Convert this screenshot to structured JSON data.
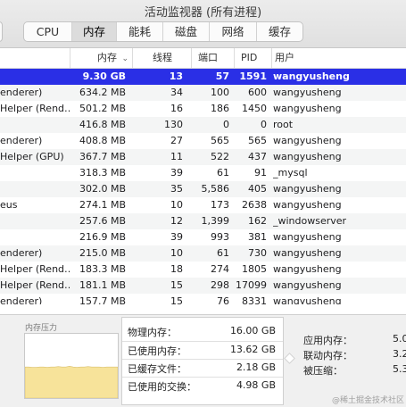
{
  "window": {
    "title": "活动监视器 (所有进程)"
  },
  "tabs": [
    {
      "label": "CPU",
      "active": false
    },
    {
      "label": "内存",
      "active": true
    },
    {
      "label": "能耗",
      "active": false
    },
    {
      "label": "磁盘",
      "active": false
    },
    {
      "label": "网络",
      "active": false
    },
    {
      "label": "缓存",
      "active": false
    }
  ],
  "table": {
    "headers": {
      "memory": "内存",
      "threads": "线程",
      "ports": "端口",
      "pid": "PID",
      "user": "用户"
    },
    "sort_indicator": "⌄",
    "rows": [
      {
        "name": "",
        "memory": "9.30 GB",
        "threads": "13",
        "ports": "57",
        "pid": "1591",
        "user": "wangyusheng",
        "selected": true
      },
      {
        "name": "enderer)",
        "memory": "634.2 MB",
        "threads": "34",
        "ports": "100",
        "pid": "600",
        "user": "wangyusheng"
      },
      {
        "name": "Helper (Rend…",
        "memory": "501.2 MB",
        "threads": "16",
        "ports": "186",
        "pid": "1450",
        "user": "wangyusheng"
      },
      {
        "name": "",
        "memory": "416.8 MB",
        "threads": "130",
        "ports": "0",
        "pid": "0",
        "user": "root"
      },
      {
        "name": "enderer)",
        "memory": "408.8 MB",
        "threads": "27",
        "ports": "565",
        "pid": "565",
        "user": "wangyusheng"
      },
      {
        "name": "Helper (GPU)",
        "memory": "367.7 MB",
        "threads": "11",
        "ports": "522",
        "pid": "437",
        "user": "wangyusheng"
      },
      {
        "name": "",
        "memory": "318.3 MB",
        "threads": "39",
        "ports": "61",
        "pid": "91",
        "user": "_mysql"
      },
      {
        "name": "",
        "memory": "302.0 MB",
        "threads": "35",
        "ports": "5,586",
        "pid": "405",
        "user": "wangyusheng"
      },
      {
        "name": "eus",
        "memory": "274.1 MB",
        "threads": "10",
        "ports": "173",
        "pid": "2638",
        "user": "wangyusheng"
      },
      {
        "name": "",
        "memory": "257.6 MB",
        "threads": "12",
        "ports": "1,399",
        "pid": "162",
        "user": "_windowserver"
      },
      {
        "name": "",
        "memory": "216.9 MB",
        "threads": "39",
        "ports": "993",
        "pid": "381",
        "user": "wangyusheng"
      },
      {
        "name": "enderer)",
        "memory": "215.0 MB",
        "threads": "10",
        "ports": "61",
        "pid": "730",
        "user": "wangyusheng"
      },
      {
        "name": "Helper (Rend…",
        "memory": "183.3 MB",
        "threads": "18",
        "ports": "274",
        "pid": "1805",
        "user": "wangyusheng"
      },
      {
        "name": "Helper (Rend…",
        "memory": "181.1 MB",
        "threads": "15",
        "ports": "298",
        "pid": "17099",
        "user": "wangyusheng"
      },
      {
        "name": "enderer)",
        "memory": "157.7 MB",
        "threads": "15",
        "ports": "76",
        "pid": "8331",
        "user": "wangyusheng"
      }
    ]
  },
  "memory_pressure": {
    "label": "内存压力",
    "fill_color": "#f7e39a",
    "levels": [
      0.78,
      0.78,
      0.77,
      0.77,
      0.78,
      0.78,
      0.77,
      0.78,
      0.78,
      0.79,
      0.78,
      0.78,
      0.8,
      0.78,
      0.77,
      0.78,
      0.78,
      0.79,
      0.78,
      0.78,
      0.78,
      0.77,
      0.78,
      0.78,
      0.78,
      0.78
    ]
  },
  "memory_stats": [
    {
      "label": "物理内存：",
      "value": "16.00 GB",
      "swatch": ""
    },
    {
      "label": "已使用内存：",
      "value": "13.62 GB",
      "swatch": ""
    },
    {
      "label": "已缓存文件：",
      "value": "2.18 GB",
      "swatch": ""
    },
    {
      "label": "已使用的交换：",
      "value": "4.98 GB",
      "swatch": ""
    }
  ],
  "memory_breakdown": [
    {
      "label": "应用内存：",
      "value": "5.0"
    },
    {
      "label": "联动内存：",
      "value": "3.2"
    },
    {
      "label": "被压缩：",
      "value": "5.3"
    }
  ],
  "watermark": "@稀土掘金技术社区"
}
